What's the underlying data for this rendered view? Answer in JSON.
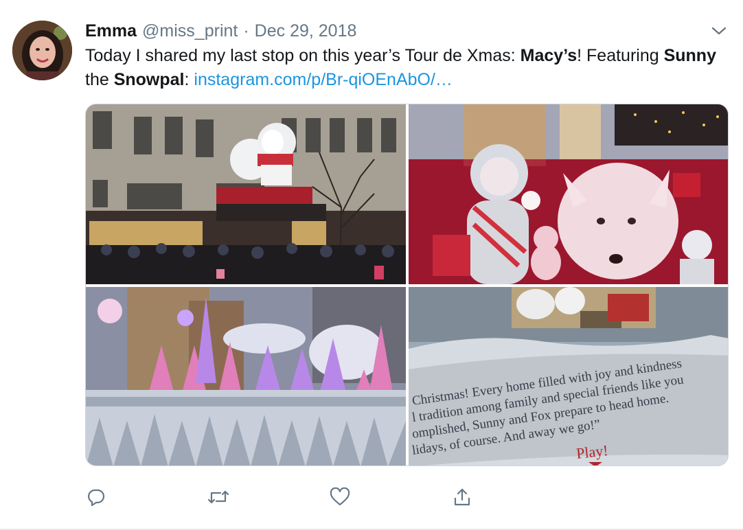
{
  "tweet": {
    "author_name": "Emma",
    "author_handle": "@miss_print",
    "separator": "·",
    "date": "Dec 29, 2018",
    "text": {
      "part1": "Today I shared my last stop on this year’s Tour de Xmas: ",
      "bold1": "Macy’s",
      "part2": "! Featuring ",
      "bold2": "Sunny",
      "part3": " the ",
      "bold3": "Snowpal",
      "part4": ": ",
      "link": "instagram.com/p/Br-qiOEnAbO/…"
    },
    "photo4_caption": {
      "line1": "Christmas! Every home filled with joy and kindness",
      "line2": "l tradition among family and special friends like you",
      "line3": "omplished, Sunny and Fox prepare to head home.",
      "line4": "lidays, of course. And away we go!”",
      "play": "Play!"
    }
  },
  "icons": {
    "menu": "chevron-down-icon",
    "reply": "reply-icon",
    "retweet": "retweet-icon",
    "like": "heart-icon",
    "share": "share-icon"
  },
  "colors": {
    "name": "#14171a",
    "secondary": "#657786",
    "link": "#1b95e0",
    "border": "#ccd6dd"
  }
}
